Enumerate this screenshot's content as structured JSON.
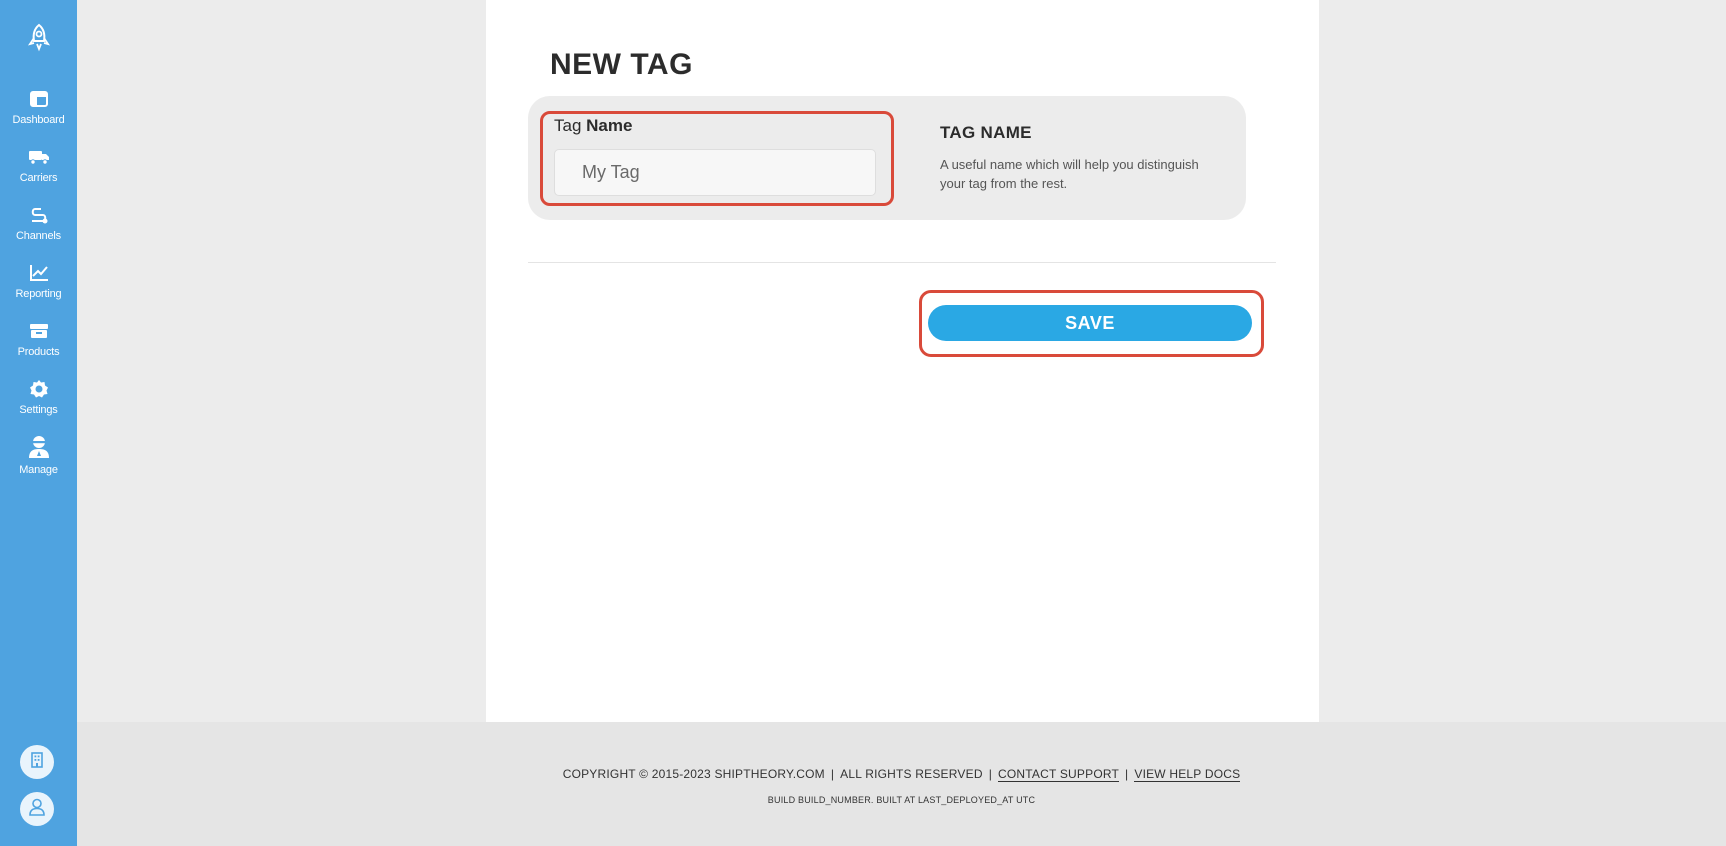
{
  "sidebar": {
    "logo_icon": "rocket-logo-icon",
    "items": [
      {
        "label": "Dashboard",
        "icon": "dashboard-icon"
      },
      {
        "label": "Carriers",
        "icon": "truck-icon"
      },
      {
        "label": "Channels",
        "icon": "route-icon"
      },
      {
        "label": "Reporting",
        "icon": "line-chart-icon"
      },
      {
        "label": "Products",
        "icon": "archive-box-icon"
      },
      {
        "label": "Settings",
        "icon": "gear-icon"
      },
      {
        "label": "Manage",
        "icon": "user-manage-icon"
      }
    ],
    "bottom_buttons": [
      {
        "icon": "building-icon"
      },
      {
        "icon": "user-profile-icon"
      }
    ]
  },
  "page": {
    "title": "NEW TAG"
  },
  "form": {
    "label_prefix": "Tag",
    "label_bold": "Name",
    "input_value": "",
    "input_placeholder": "My Tag",
    "help_title": "TAG NAME",
    "help_text": "A useful name which will help you distinguish your tag from the rest."
  },
  "actions": {
    "save_label": "SAVE"
  },
  "footer": {
    "copyright": "COPYRIGHT © 2015-2023 SHIPTHEORY.COM",
    "rights": "ALL RIGHTS RESERVED",
    "contact_support": "CONTACT SUPPORT",
    "help_docs": "VIEW HELP DOCS",
    "build_info": "BUILD BUILD_NUMBER. BUILT AT LAST_DEPLOYED_AT UTC"
  },
  "colors": {
    "sidebar": "#4fa3e0",
    "accent": "#2aa8e4",
    "highlight": "#d94a3a",
    "background": "#ececec"
  }
}
